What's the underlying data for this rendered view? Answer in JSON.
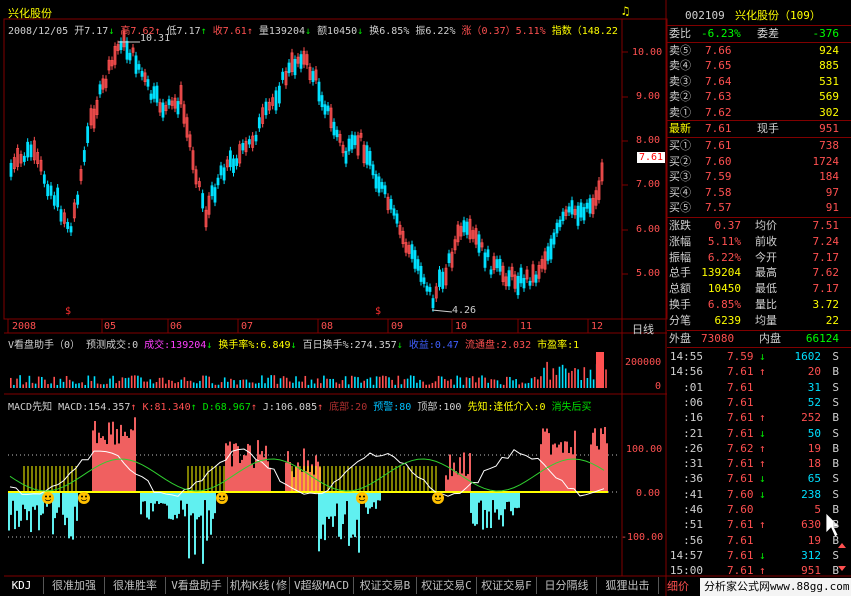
{
  "main_chart": {
    "stock_name": "兴化股份",
    "info": {
      "date": "2008/12/05",
      "open": "开7.17",
      "high": "高7.62",
      "low": "低7.17",
      "close": "收7.61",
      "volume": "量139204",
      "amount": "额10450",
      "turnover": "换6.85%",
      "amplitude": "振6.22%",
      "change": "涨（0.37）5.11%",
      "index": "指数（148.22"
    },
    "price_labels": [
      "10.00",
      "9.00",
      "8.00",
      "7.00",
      "6.00",
      "5.00"
    ],
    "last_price_tag": "7.61",
    "high_mark": "10.31",
    "low_mark": "4.26",
    "date_labels": [
      "2008",
      "05",
      "06",
      "07",
      "08",
      "09",
      "10",
      "11",
      "12"
    ],
    "period_label": "日线",
    "s_marks": [
      "$",
      "$"
    ]
  },
  "volume_panel": {
    "title": "V看盘助手（0） 预测成交:0",
    "cj": "成交:139204",
    "hsl": "换手率%:6.849",
    "bai": "百日换手%:274.357",
    "sy": "收益:0.47",
    "lt": "流通盘:2.032",
    "syl": "市盈率:1",
    "axis": [
      "200000",
      "0"
    ]
  },
  "macd_panel": {
    "title": "MACD先知",
    "macd": "MACD:154.357",
    "k": "K:81.340",
    "d": "D:68.967",
    "j": "J:106.085",
    "bottom": "底部:20",
    "alert": "预警:80",
    "top": "顶部:100",
    "xz": "先知:逢低介入:0",
    "xs": "消失后买",
    "axis": [
      "100.00",
      "0.00",
      "-100.00"
    ]
  },
  "quote": {
    "code": "002109",
    "name": "兴化股份（109）",
    "weibi_label": "委比",
    "weibi_value": "-6.23%",
    "weicha_label": "委差",
    "weicha_value": "-376",
    "sells": [
      {
        "label": "卖⑤",
        "price": "7.66",
        "vol": "924"
      },
      {
        "label": "卖④",
        "price": "7.65",
        "vol": "885"
      },
      {
        "label": "卖③",
        "price": "7.64",
        "vol": "531"
      },
      {
        "label": "卖②",
        "price": "7.63",
        "vol": "569"
      },
      {
        "label": "卖①",
        "price": "7.62",
        "vol": "302"
      }
    ],
    "latest_label": "最新",
    "latest_value": "7.61",
    "xianshou_label": "现手",
    "xianshou_value": "951",
    "buys": [
      {
        "label": "买①",
        "price": "7.61",
        "vol": "738"
      },
      {
        "label": "买②",
        "price": "7.60",
        "vol": "1724"
      },
      {
        "label": "买③",
        "price": "7.59",
        "vol": "184"
      },
      {
        "label": "买④",
        "price": "7.58",
        "vol": "97"
      },
      {
        "label": "买⑤",
        "price": "7.57",
        "vol": "91"
      }
    ],
    "stats": [
      {
        "l1": "涨跌",
        "v1": "0.37",
        "l2": "均价",
        "v2": "7.51"
      },
      {
        "l1": "涨幅",
        "v1": "5.11%",
        "l2": "前收",
        "v2": "7.24"
      },
      {
        "l1": "振幅",
        "v1": "6.22%",
        "l2": "今开",
        "v2": "7.17"
      },
      {
        "l1": "总手",
        "v1": "139204",
        "l2": "最高",
        "v2": "7.62"
      },
      {
        "l1": "总额",
        "v1": "10450",
        "l2": "最低",
        "v2": "7.17"
      },
      {
        "l1": "换手",
        "v1": "6.85%",
        "l2": "量比",
        "v2": "3.72"
      },
      {
        "l1": "分笔",
        "v1": "6239",
        "l2": "均量",
        "v2": "22"
      }
    ],
    "waipan_label": "外盘",
    "waipan_value": "73080",
    "neipan_label": "内盘",
    "neipan_value": "66124"
  },
  "ticks": [
    {
      "time": "14:55",
      "price": "7.59",
      "arrow": "↓",
      "vol": "1602",
      "side": "S"
    },
    {
      "time": "14:56",
      "price": "7.61",
      "arrow": "↑",
      "vol": "20",
      "side": "B"
    },
    {
      "time": ":01",
      "price": "7.61",
      "arrow": "",
      "vol": "31",
      "side": "S"
    },
    {
      "time": ":06",
      "price": "7.61",
      "arrow": "",
      "vol": "52",
      "side": "S"
    },
    {
      "time": ":16",
      "price": "7.61",
      "arrow": "↑",
      "vol": "252",
      "side": "B"
    },
    {
      "time": ":21",
      "price": "7.61",
      "arrow": "↓",
      "vol": "50",
      "side": "S"
    },
    {
      "time": ":26",
      "price": "7.62",
      "arrow": "↑",
      "vol": "19",
      "side": "B"
    },
    {
      "time": ":31",
      "price": "7.61",
      "arrow": "↑",
      "vol": "18",
      "side": "B"
    },
    {
      "time": ":36",
      "price": "7.61",
      "arrow": "↓",
      "vol": "65",
      "side": "S"
    },
    {
      "time": ":41",
      "price": "7.60",
      "arrow": "↓",
      "vol": "238",
      "side": "S"
    },
    {
      "time": ":46",
      "price": "7.60",
      "arrow": "",
      "vol": "5",
      "side": "B"
    },
    {
      "time": ":51",
      "price": "7.61",
      "arrow": "↑",
      "vol": "630",
      "side": "B"
    },
    {
      "time": ":56",
      "price": "7.61",
      "arrow": "",
      "vol": "19",
      "side": "B"
    },
    {
      "time": "14:57",
      "price": "7.61",
      "arrow": "↓",
      "vol": "312",
      "side": "S"
    },
    {
      "time": "15:00",
      "price": "7.61",
      "arrow": "↑",
      "vol": "951",
      "side": "B"
    }
  ],
  "tabs": [
    "KDJ",
    "很准加强",
    "很准胜率",
    "V看盘助手",
    "机构K线(修",
    "V超级MACD",
    "权证交易B",
    "权证交易C",
    "权证交易F",
    "日分隔线",
    "狐狸出击"
  ],
  "tab_detail": "细价",
  "watermark": "分析家公式网www.88gg.com",
  "colors": {
    "up": "#ff5050",
    "down": "#00e0ff",
    "border": "#800000",
    "yellow": "#ffff00",
    "fill_red": "#f06060",
    "fill_cyan": "#60f0f0"
  }
}
